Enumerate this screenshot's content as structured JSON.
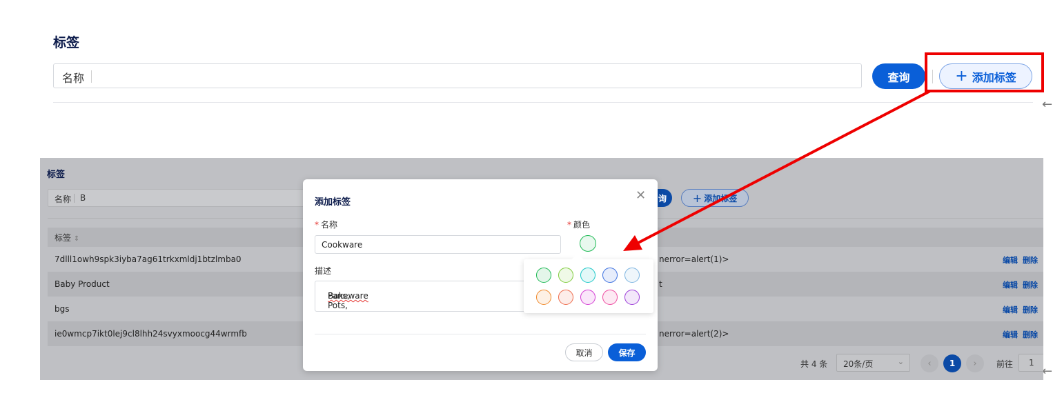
{
  "top": {
    "title": "标签",
    "search_label": "名称",
    "query_label": "查询",
    "add_label": "添加标签"
  },
  "screenshot": {
    "title": "标签",
    "search_label": "名称",
    "search_value": "B",
    "query_label": "询",
    "add_label": "添加标签",
    "column_header": "标签",
    "rows": [
      {
        "name": "7dlll1owh9spk3iyba7ag61trkxmldj1btzlmba0",
        "desc": "nerror=alert(1)>"
      },
      {
        "name": "Baby Product",
        "desc": "t"
      },
      {
        "name": "bgs",
        "desc": ""
      },
      {
        "name": "ie0wmcp7ikt0lej9cl8lhh24svyxmoocg44wrmfb",
        "desc": "nerror=alert(2)>"
      }
    ],
    "edit_label": "编辑",
    "delete_label": "删除",
    "total": "共 4 条",
    "page_size": "20条/页",
    "current_page": "1",
    "goto_label": "前往",
    "goto_value": "1"
  },
  "modal": {
    "title": "添加标签",
    "name_label": "名称",
    "name_value": "Cookware",
    "color_label": "颜色",
    "desc_label": "描述",
    "desc_value_prefix": "Pans, Pots, ",
    "desc_value_suffix": "Bakeware",
    "cancel_label": "取消",
    "save_label": "保存"
  },
  "colors": {
    "selected": "#1db954",
    "swatches": [
      "#1db954",
      "#7ecb3a",
      "#18c7c7",
      "#3a6fe0",
      "#7bb3e0",
      "#f0892b",
      "#ee6a4a",
      "#d33ad3",
      "#ee4aa0",
      "#9b3ad8"
    ]
  }
}
